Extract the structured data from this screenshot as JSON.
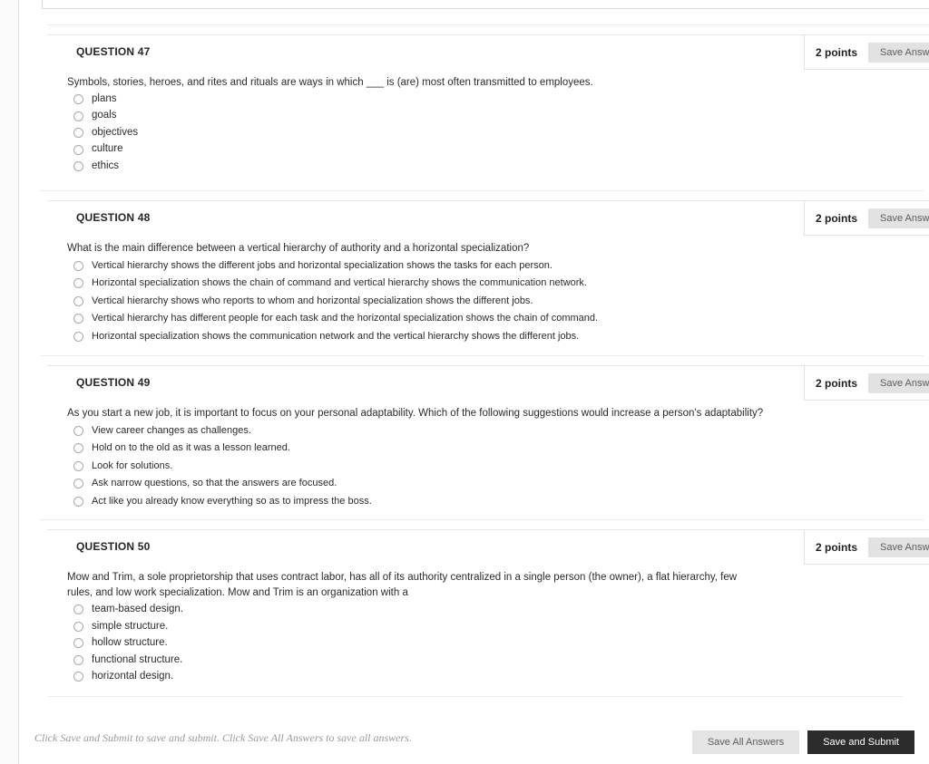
{
  "footer": {
    "note": "Click Save and Submit to save and submit. Click Save All Answers to save all answers.",
    "save_all_label": "Save All Answers",
    "save_submit_label": "Save and Submit"
  },
  "labels": {
    "save_answer": "Save Answer",
    "points": "2 points"
  },
  "questions": [
    {
      "label": "QUESTION 47",
      "points": "2 points",
      "save_answer": "Save Answer",
      "text": "Symbols, stories, heroes, and rites and rituals are ways in which ___ is (are) most often transmitted to employees.",
      "options": [
        "plans",
        "goals",
        "objectives",
        "culture",
        "ethics"
      ]
    },
    {
      "label": "QUESTION 48",
      "points": "2 points",
      "save_answer": "Save Answer",
      "text": "What is the main difference between a vertical hierarchy of authority and a horizontal specialization?",
      "options": [
        "Vertical hierarchy shows the different jobs and horizontal specialization shows the tasks for each person.",
        "Horizontal specialization shows the chain of command and vertical hierarchy shows the communication network.",
        "Vertical hierarchy shows who reports to whom and horizontal specialization shows the different jobs.",
        "Vertical hierarchy has different people for each task and the horizontal specialization shows the chain of command.",
        "Horizontal specialization shows the communication network and the vertical hierarchy shows the different jobs."
      ]
    },
    {
      "label": "QUESTION 49",
      "points": "2 points",
      "save_answer": "Save Answer",
      "text": "As you start a new job, it is important to focus on your personal adaptability. Which of the following suggestions would increase a person's adaptability?",
      "options": [
        "View career changes as challenges.",
        "Hold on to the old as it was a lesson learned.",
        "Look for solutions.",
        "Ask narrow questions, so that the answers are focused.",
        "Act like you already know everything so as to impress the boss."
      ]
    },
    {
      "label": "QUESTION 50",
      "points": "2 points",
      "save_answer": "Save Answer",
      "text": "Mow and Trim, a sole proprietorship that uses contract labor, has all of its authority centralized in a single person (the owner), a flat hierarchy, few rules, and low work specialization. Mow and Trim is an organization with a",
      "options": [
        "team-based design.",
        "simple structure.",
        "hollow structure.",
        "functional structure.",
        "horizontal design."
      ]
    }
  ]
}
